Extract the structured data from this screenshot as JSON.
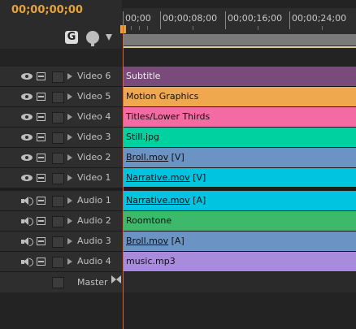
{
  "timecode": "00;00;00;00",
  "ruler": {
    "ticks": [
      "00;00",
      "00;00;08;00",
      "00;00;16;00",
      "00;00;24;00"
    ]
  },
  "toolbar": {
    "snap_label": "G"
  },
  "colors": {
    "timecode": "#e8a23a",
    "playhead": "#e85a30",
    "subtitle": "#7a4a7a",
    "motion_graphics": "#f0a84e",
    "titles": "#f46aa3",
    "still": "#00d1a0",
    "broll_v": "#6b93c4",
    "narrative_v": "#00c4e0",
    "narrative_a": "#00c4e0",
    "roomtone": "#3cb96a",
    "broll_a": "#6b93c4",
    "music": "#a98bdd"
  },
  "video_tracks": [
    {
      "label": "Video 6",
      "clip": "Subtitle",
      "suffix": "",
      "underline": false
    },
    {
      "label": "Video 5",
      "clip": "Motion Graphics",
      "suffix": "",
      "underline": false
    },
    {
      "label": "Video 4",
      "clip": "Titles/Lower Thirds",
      "suffix": "",
      "underline": false
    },
    {
      "label": "Video 3",
      "clip": "Still.jpg",
      "suffix": "",
      "underline": false
    },
    {
      "label": "Video 2",
      "clip": "Broll.mov",
      "suffix": "[V]",
      "underline": true
    },
    {
      "label": "Video 1",
      "clip": "Narrative.mov",
      "suffix": "[V]",
      "underline": true
    }
  ],
  "audio_tracks": [
    {
      "label": "Audio 1",
      "clip": "Narrative.mov",
      "suffix": "[A]",
      "underline": true
    },
    {
      "label": "Audio 2",
      "clip": "Roomtone",
      "suffix": "",
      "underline": false
    },
    {
      "label": "Audio 3",
      "clip": "Broll.mov",
      "suffix": "[A]",
      "underline": true
    },
    {
      "label": "Audio 4",
      "clip": "music.mp3",
      "suffix": "",
      "underline": false
    }
  ],
  "master": {
    "label": "Master"
  }
}
